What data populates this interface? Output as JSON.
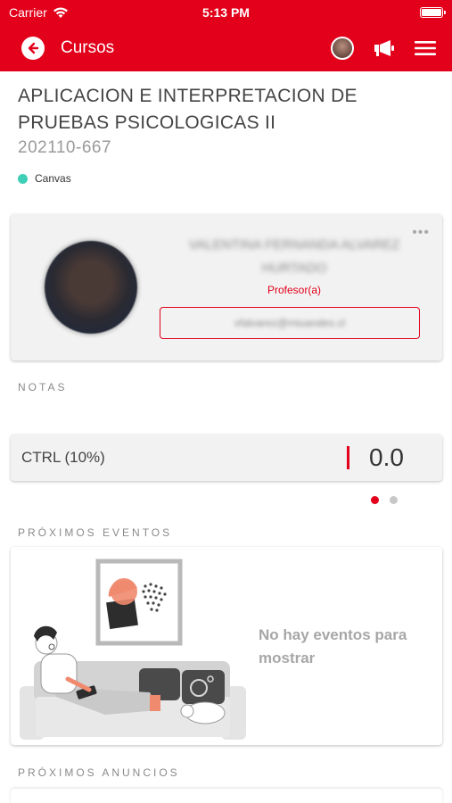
{
  "status_bar": {
    "carrier": "Carrier",
    "time": "5:13 PM"
  },
  "nav": {
    "back_icon": "arrow-left-circle-icon",
    "title": "Cursos",
    "actions": [
      "avatar",
      "megaphone-icon",
      "hamburger-menu-icon"
    ]
  },
  "course": {
    "title": "APLICACION E INTERPRETACION DE PRUEBAS PSICOLOGICAS II",
    "code": "202110-667",
    "platform": "Canvas",
    "platform_color": "#3fcfb6"
  },
  "teacher": {
    "name": "VALENTINA FERNANDA ALVAREZ HURTADO",
    "role": "Profesor(a)",
    "email": "vfalvarez@miuandes.cl",
    "more_icon": "ellipsis-icon"
  },
  "grades": {
    "section_label": "NOTAS",
    "items": [
      {
        "name": "CTRL (10%)",
        "value": "0.0"
      }
    ],
    "pager": {
      "pages": 2,
      "active": 1
    }
  },
  "events": {
    "section_label": "PRÓXIMOS EVENTOS",
    "empty_text": "No hay eventos para mostrar"
  },
  "announcements": {
    "section_label": "PRÓXIMOS ANUNCIOS"
  },
  "colors": {
    "brand_red": "#e2001a",
    "card_bg": "#f2f2f2",
    "pager_inactive": "#c8c8c8"
  }
}
